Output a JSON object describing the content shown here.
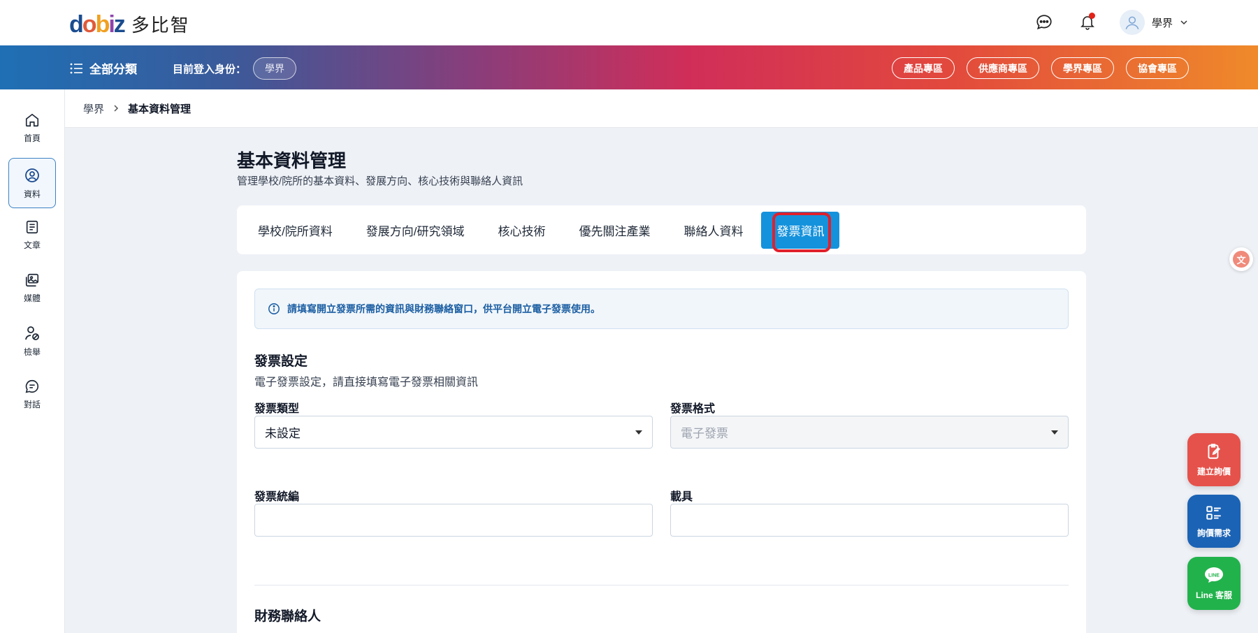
{
  "header": {
    "logo_mark": "dobiz",
    "logo_text": "多比智",
    "user_name": "學界"
  },
  "nav_bar": {
    "all_categories": "全部分類",
    "identity_label": "目前登入身份：",
    "identity_value": "學界",
    "zones": [
      "產品專區",
      "供應商專區",
      "學界專區",
      "協會專區"
    ]
  },
  "sidebar": {
    "items": [
      {
        "label": "首頁",
        "icon": "home-icon"
      },
      {
        "label": "資料",
        "icon": "profile-icon"
      },
      {
        "label": "文章",
        "icon": "article-icon"
      },
      {
        "label": "媒體",
        "icon": "media-icon"
      },
      {
        "label": "檢舉",
        "icon": "report-icon"
      },
      {
        "label": "對話",
        "icon": "chat-icon"
      }
    ],
    "active": "資料"
  },
  "breadcrumb": {
    "parent": "學界",
    "current": "基本資料管理"
  },
  "page": {
    "title": "基本資料管理",
    "subtitle": "管理學校/院所的基本資料、發展方向、核心技術與聯絡人資訊"
  },
  "tabs": [
    "學校/院所資料",
    "發展方向/研究領域",
    "核心技術",
    "優先關注產業",
    "聯絡人資料",
    "發票資訊"
  ],
  "active_tab": "發票資訊",
  "form": {
    "notice": "請填寫開立發票所需的資訊與財務聯絡窗口，供平台開立電子發票使用。",
    "invoice_section_title": "發票設定",
    "invoice_section_sub": "電子發票設定，請直接填寫電子發票相關資訊",
    "invoice_type_label": "發票類型",
    "invoice_type_value": "未設定",
    "invoice_format_label": "發票格式",
    "invoice_format_value": "電子發票",
    "tax_id_label": "發票統編",
    "tax_id_value": "",
    "carrier_label": "載具",
    "carrier_value": "",
    "finance_section_title": "財務聯絡人"
  },
  "floating": {
    "create_inquiry": "建立詢價",
    "inquiry_needs": "詢價需求",
    "line_service": "Line 客服",
    "line_badge": "LINE"
  },
  "colors": {
    "accent": "#1592dc",
    "highlight": "#e0202c",
    "create_inquiry_bg": "#e5524b",
    "inquiry_needs_bg": "#1b63b5",
    "line_bg": "#22b24c"
  }
}
